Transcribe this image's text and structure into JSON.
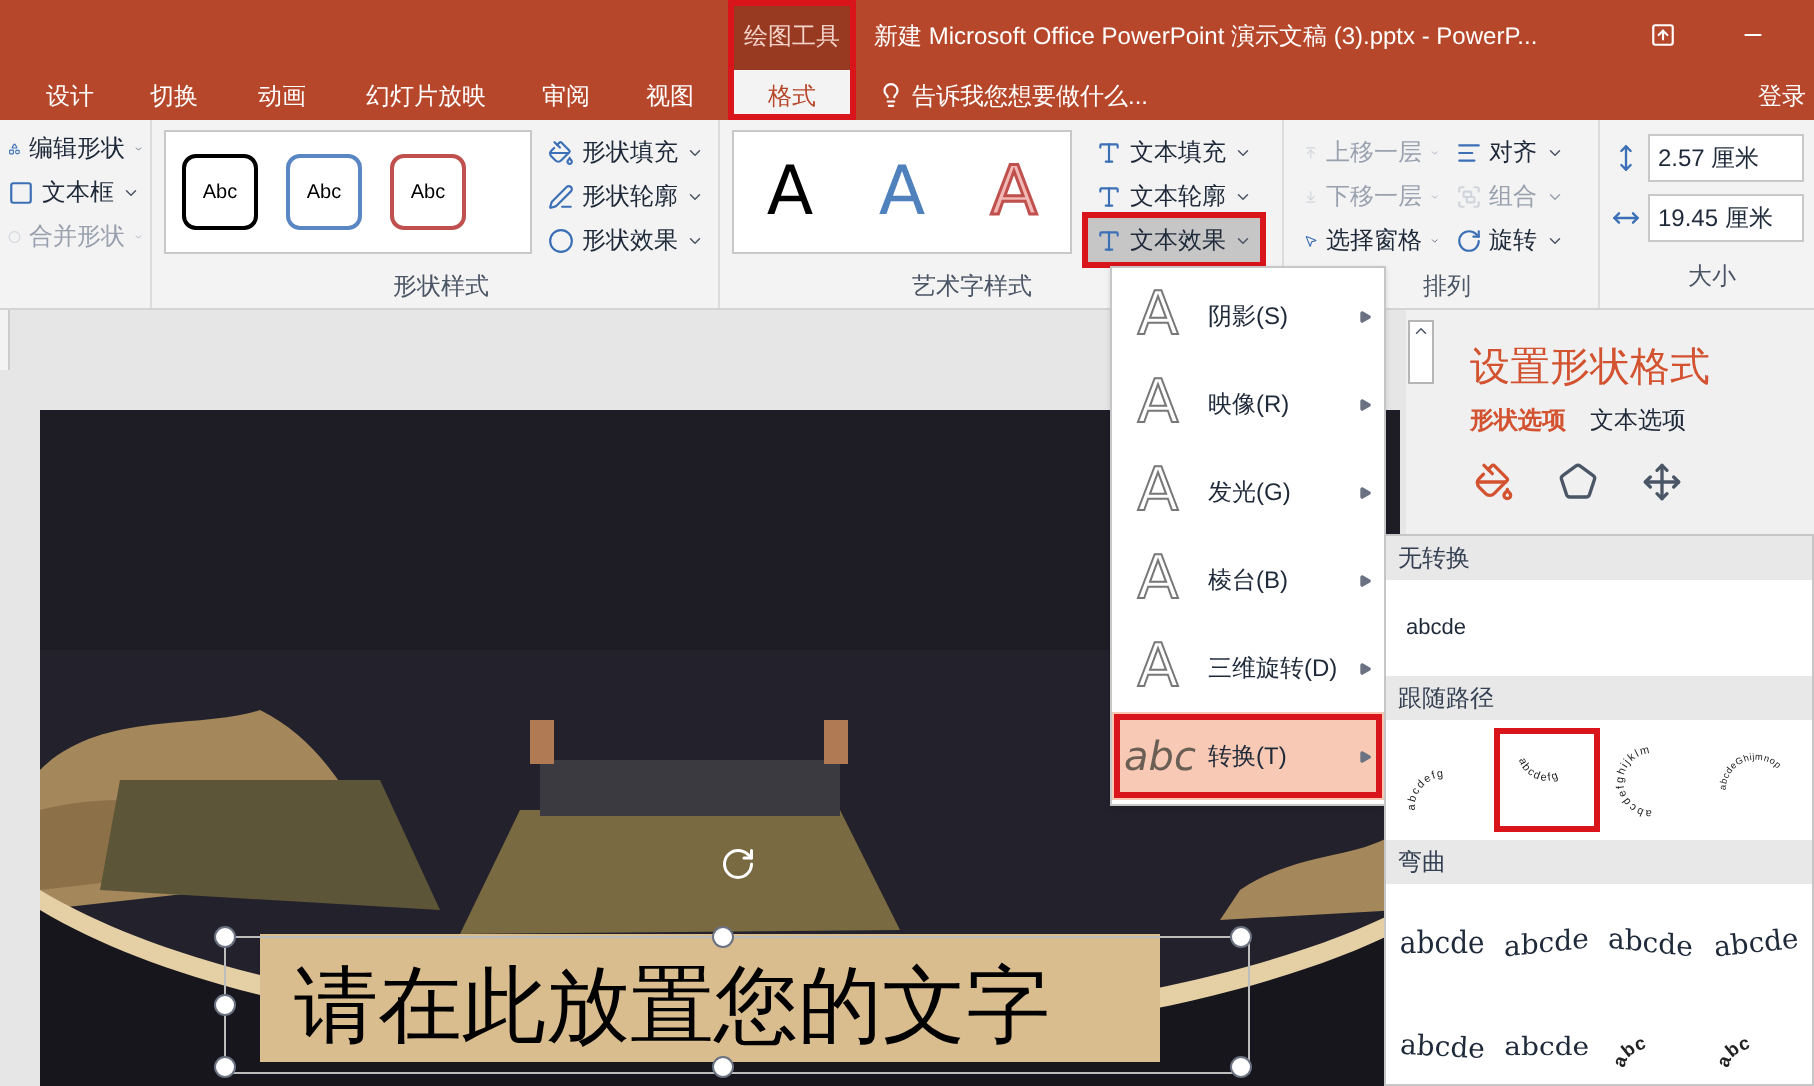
{
  "title_bar": {
    "context_group": "绘图工具",
    "context_highlighted": true,
    "title": "新建 Microsoft Office PowerPoint 演示文稿 (3).pptx - PowerP..."
  },
  "tabs": [
    {
      "label": "设计",
      "selected": false
    },
    {
      "label": "切换",
      "selected": false
    },
    {
      "label": "动画",
      "selected": false
    },
    {
      "label": "幻灯片放映",
      "selected": false
    },
    {
      "label": "审阅",
      "selected": false
    },
    {
      "label": "视图",
      "selected": false
    },
    {
      "label": "格式",
      "selected": true
    }
  ],
  "tell_me": "告诉我您想要做什么...",
  "sign_in": "登录",
  "ribbon": {
    "insert_shapes": {
      "commands": [
        {
          "label": "编辑形状",
          "disabled": false
        },
        {
          "label": "文本框",
          "disabled": false
        },
        {
          "label": "合并形状",
          "disabled": true
        }
      ]
    },
    "shape_styles": {
      "label": "形状样式",
      "presets": [
        {
          "text": "Abc",
          "color": "#000000"
        },
        {
          "text": "Abc",
          "color": "#5b86c4"
        },
        {
          "text": "Abc",
          "color": "#c0504d"
        }
      ],
      "commands": [
        {
          "label": "形状填充"
        },
        {
          "label": "形状轮廓"
        },
        {
          "label": "形状效果"
        }
      ]
    },
    "wordart_styles": {
      "label": "艺术字样式",
      "presets": [
        {
          "text": "A",
          "kind": "black"
        },
        {
          "text": "A",
          "kind": "blue"
        },
        {
          "text": "A",
          "kind": "red_outline"
        }
      ],
      "commands": [
        {
          "label": "文本填充",
          "pressed": false,
          "highlighted": false
        },
        {
          "label": "文本轮廓",
          "pressed": false,
          "highlighted": false
        },
        {
          "label": "文本效果",
          "pressed": true,
          "highlighted": true
        }
      ]
    },
    "arrange": {
      "label": "排列",
      "commands": [
        {
          "label": "上移一层",
          "disabled": true
        },
        {
          "label": "下移一层",
          "disabled": true
        },
        {
          "label": "选择窗格",
          "disabled": false
        },
        {
          "label": "对齐",
          "disabled": false
        },
        {
          "label": "组合",
          "disabled": true
        },
        {
          "label": "旋转",
          "disabled": false
        }
      ]
    },
    "size": {
      "label": "大小",
      "fields": [
        {
          "value": "2.57 厘米"
        },
        {
          "value": "19.45 厘米"
        }
      ]
    }
  },
  "slide": {
    "text_box": "请在此放置您的文字"
  },
  "format_pane": {
    "title": "设置形状格式",
    "tabs": [
      {
        "label": "形状选项",
        "selected": true
      },
      {
        "label": "文本选项",
        "selected": false
      }
    ],
    "icons": [
      {
        "selected": true
      },
      {
        "selected": false
      },
      {
        "selected": false
      }
    ]
  },
  "text_effects_menu": [
    {
      "icon_text": "A",
      "label": "阴影(S)",
      "selected": false,
      "highlighted": false
    },
    {
      "icon_text": "A",
      "label": "映像(R)",
      "selected": false,
      "highlighted": false
    },
    {
      "icon_text": "A",
      "label": "发光(G)",
      "selected": false,
      "highlighted": false
    },
    {
      "icon_text": "A",
      "label": "棱台(B)",
      "selected": false,
      "highlighted": false
    },
    {
      "icon_text": "A",
      "label": "三维旋转(D)",
      "selected": false,
      "highlighted": false
    },
    {
      "icon_text": "abc",
      "label": "转换(T)",
      "selected": true,
      "highlighted": true
    }
  ],
  "transform_submenu": [
    {
      "header": "无转换",
      "items": [
        {
          "kind": "plain",
          "text": "abcde",
          "selected": false
        }
      ]
    },
    {
      "header": "跟随路径",
      "items": [
        {
          "kind": "arch_up",
          "text": "abcdefg",
          "selected": false
        },
        {
          "kind": "arch_down",
          "text": "abcdefg",
          "selected": true
        },
        {
          "kind": "circle",
          "text": "abcdefghijklm",
          "selected": false
        },
        {
          "kind": "button",
          "text": "abcdeGhijmnop",
          "selected": false
        }
      ]
    },
    {
      "header": "弯曲",
      "items": [
        {
          "kind": "warp_a",
          "text": "abcde",
          "selected": false
        },
        {
          "kind": "warp_b",
          "text": "abcde",
          "selected": false
        },
        {
          "kind": "warp_c",
          "text": "abcde",
          "selected": false
        },
        {
          "kind": "warp_d",
          "text": "abcde",
          "selected": false
        },
        {
          "kind": "warp_e",
          "text": "abcde",
          "selected": false
        },
        {
          "kind": "warp_f",
          "text": "abcde",
          "selected": false
        },
        {
          "kind": "ring",
          "text": "abc",
          "selected": false
        },
        {
          "kind": "ring",
          "text": "abc",
          "selected": false
        }
      ]
    }
  ]
}
